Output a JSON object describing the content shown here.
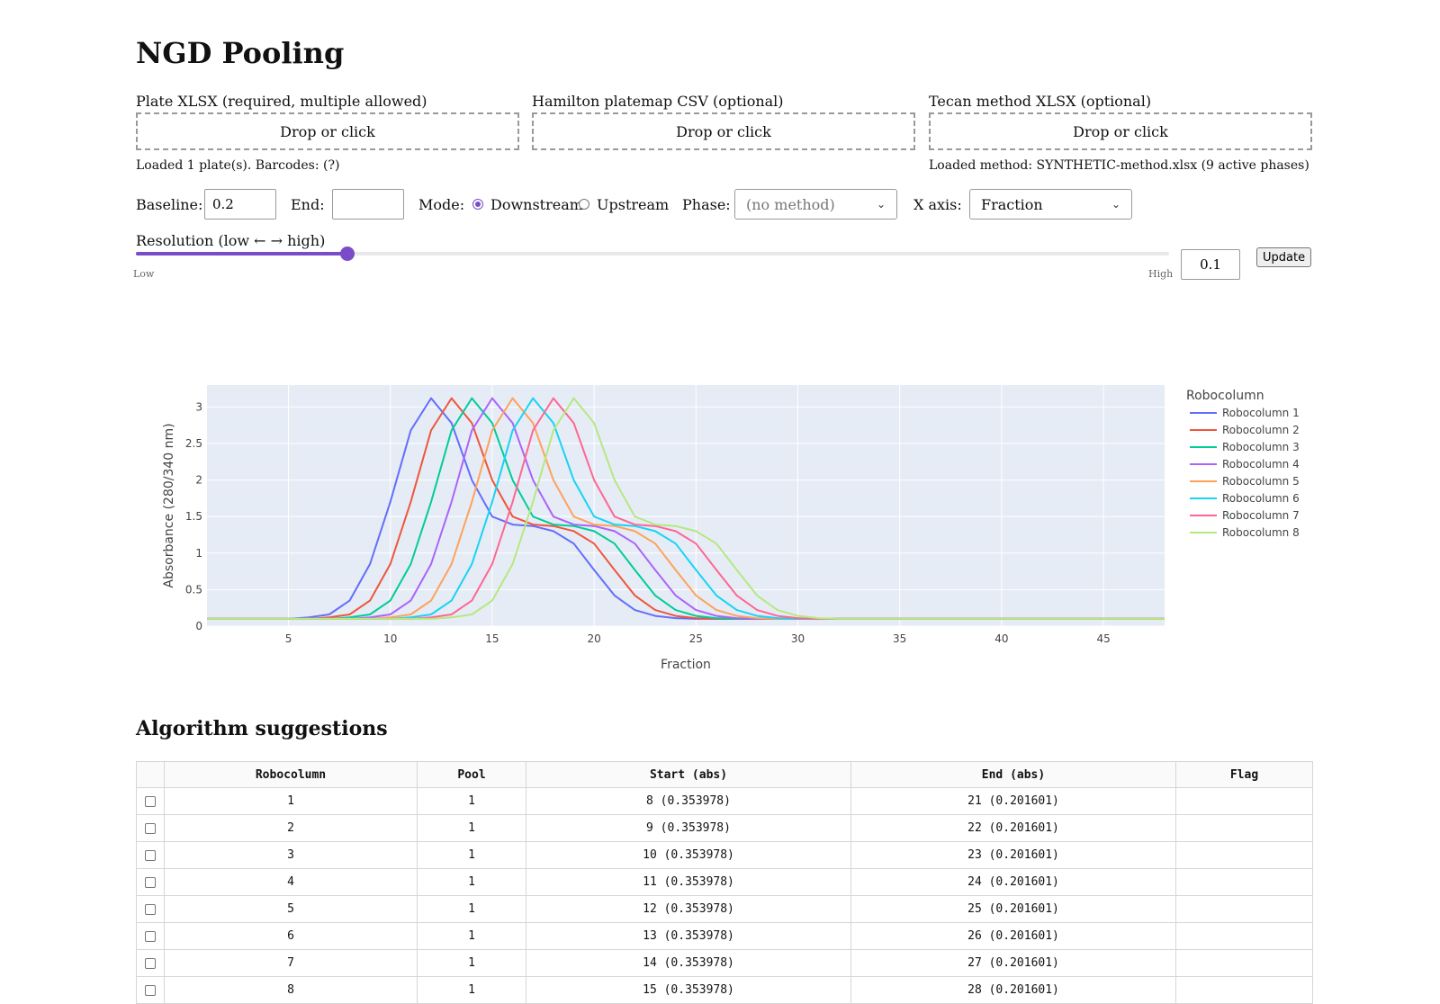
{
  "page": {
    "title": "NGD Pooling"
  },
  "uploads": [
    {
      "label": "Plate XLSX (required, multiple allowed)",
      "prompt": "Drop or click"
    },
    {
      "label": "Hamilton platemap CSV (optional)",
      "prompt": "Drop or click"
    },
    {
      "label": "Tecan method XLSX (optional)",
      "prompt": "Drop or click"
    }
  ],
  "status": {
    "plates": "Loaded 1 plate(s). Barcodes: (?)",
    "method": "Loaded method: SYNTHETIC-method.xlsx (9 active phases)"
  },
  "controls": {
    "baseline_label": "Baseline:",
    "baseline_value": "0.2",
    "end_label": "End:",
    "end_value": "",
    "mode_label": "Mode:",
    "mode_options": [
      "Downstream",
      "Upstream"
    ],
    "mode_selected": "Downstream",
    "phase_label": "Phase:",
    "phase_value": "(no method)",
    "xaxis_label": "X axis:",
    "xaxis_value": "Fraction"
  },
  "resolution": {
    "label": "Resolution (low ← → high)",
    "low_label": "Low",
    "high_label": "High",
    "value": "0.1",
    "fraction": 0.205,
    "update_label": "Update"
  },
  "chart_data": {
    "type": "line",
    "xlabel": "Fraction",
    "ylabel": "Absorbance (280/340 nm)",
    "xlim": [
      1,
      48
    ],
    "ylim": [
      0,
      3.3
    ],
    "xticks": [
      5,
      10,
      15,
      20,
      25,
      30,
      35,
      40,
      45
    ],
    "yticks": [
      0,
      0.5,
      1,
      1.5,
      2,
      2.5,
      3
    ],
    "ytick_labels": [
      "0",
      "0.5",
      "1",
      "1.5",
      "2",
      "2.5",
      "3"
    ],
    "legend_title": "Robocolumn",
    "legend_position": "right",
    "grid": true,
    "base_profile": [
      0.1,
      0.1,
      0.1,
      0.1,
      0.1,
      0.12,
      0.16,
      0.35,
      0.85,
      1.7,
      2.68,
      3.12,
      2.78,
      2.0,
      1.5,
      1.39,
      1.37,
      1.3,
      1.13,
      0.77,
      0.42,
      0.22,
      0.14,
      0.11,
      0.1,
      0.1
    ],
    "series": [
      {
        "name": "Robocolumn 1",
        "color": "#636efa",
        "shift": 0
      },
      {
        "name": "Robocolumn 2",
        "color": "#ef553b",
        "shift": 1
      },
      {
        "name": "Robocolumn 3",
        "color": "#00cc96",
        "shift": 2
      },
      {
        "name": "Robocolumn 4",
        "color": "#ab63fa",
        "shift": 3
      },
      {
        "name": "Robocolumn 5",
        "color": "#ffa15a",
        "shift": 4
      },
      {
        "name": "Robocolumn 6",
        "color": "#19d3f3",
        "shift": 5
      },
      {
        "name": "Robocolumn 7",
        "color": "#ff6692",
        "shift": 6
      },
      {
        "name": "Robocolumn 8",
        "color": "#b6e880",
        "shift": 7
      }
    ]
  },
  "suggestions": {
    "title": "Algorithm suggestions",
    "columns": [
      "Robocolumn",
      "Pool",
      "Start (abs)",
      "End (abs)",
      "Flag"
    ],
    "rows": [
      [
        "1",
        "1",
        "8 (0.353978)",
        "21 (0.201601)",
        ""
      ],
      [
        "2",
        "1",
        "9 (0.353978)",
        "22 (0.201601)",
        ""
      ],
      [
        "3",
        "1",
        "10 (0.353978)",
        "23 (0.201601)",
        ""
      ],
      [
        "4",
        "1",
        "11 (0.353978)",
        "24 (0.201601)",
        ""
      ],
      [
        "5",
        "1",
        "12 (0.353978)",
        "25 (0.201601)",
        ""
      ],
      [
        "6",
        "1",
        "13 (0.353978)",
        "26 (0.201601)",
        ""
      ],
      [
        "7",
        "1",
        "14 (0.353978)",
        "27 (0.201601)",
        ""
      ],
      [
        "8",
        "1",
        "15 (0.353978)",
        "28 (0.201601)",
        ""
      ]
    ]
  }
}
